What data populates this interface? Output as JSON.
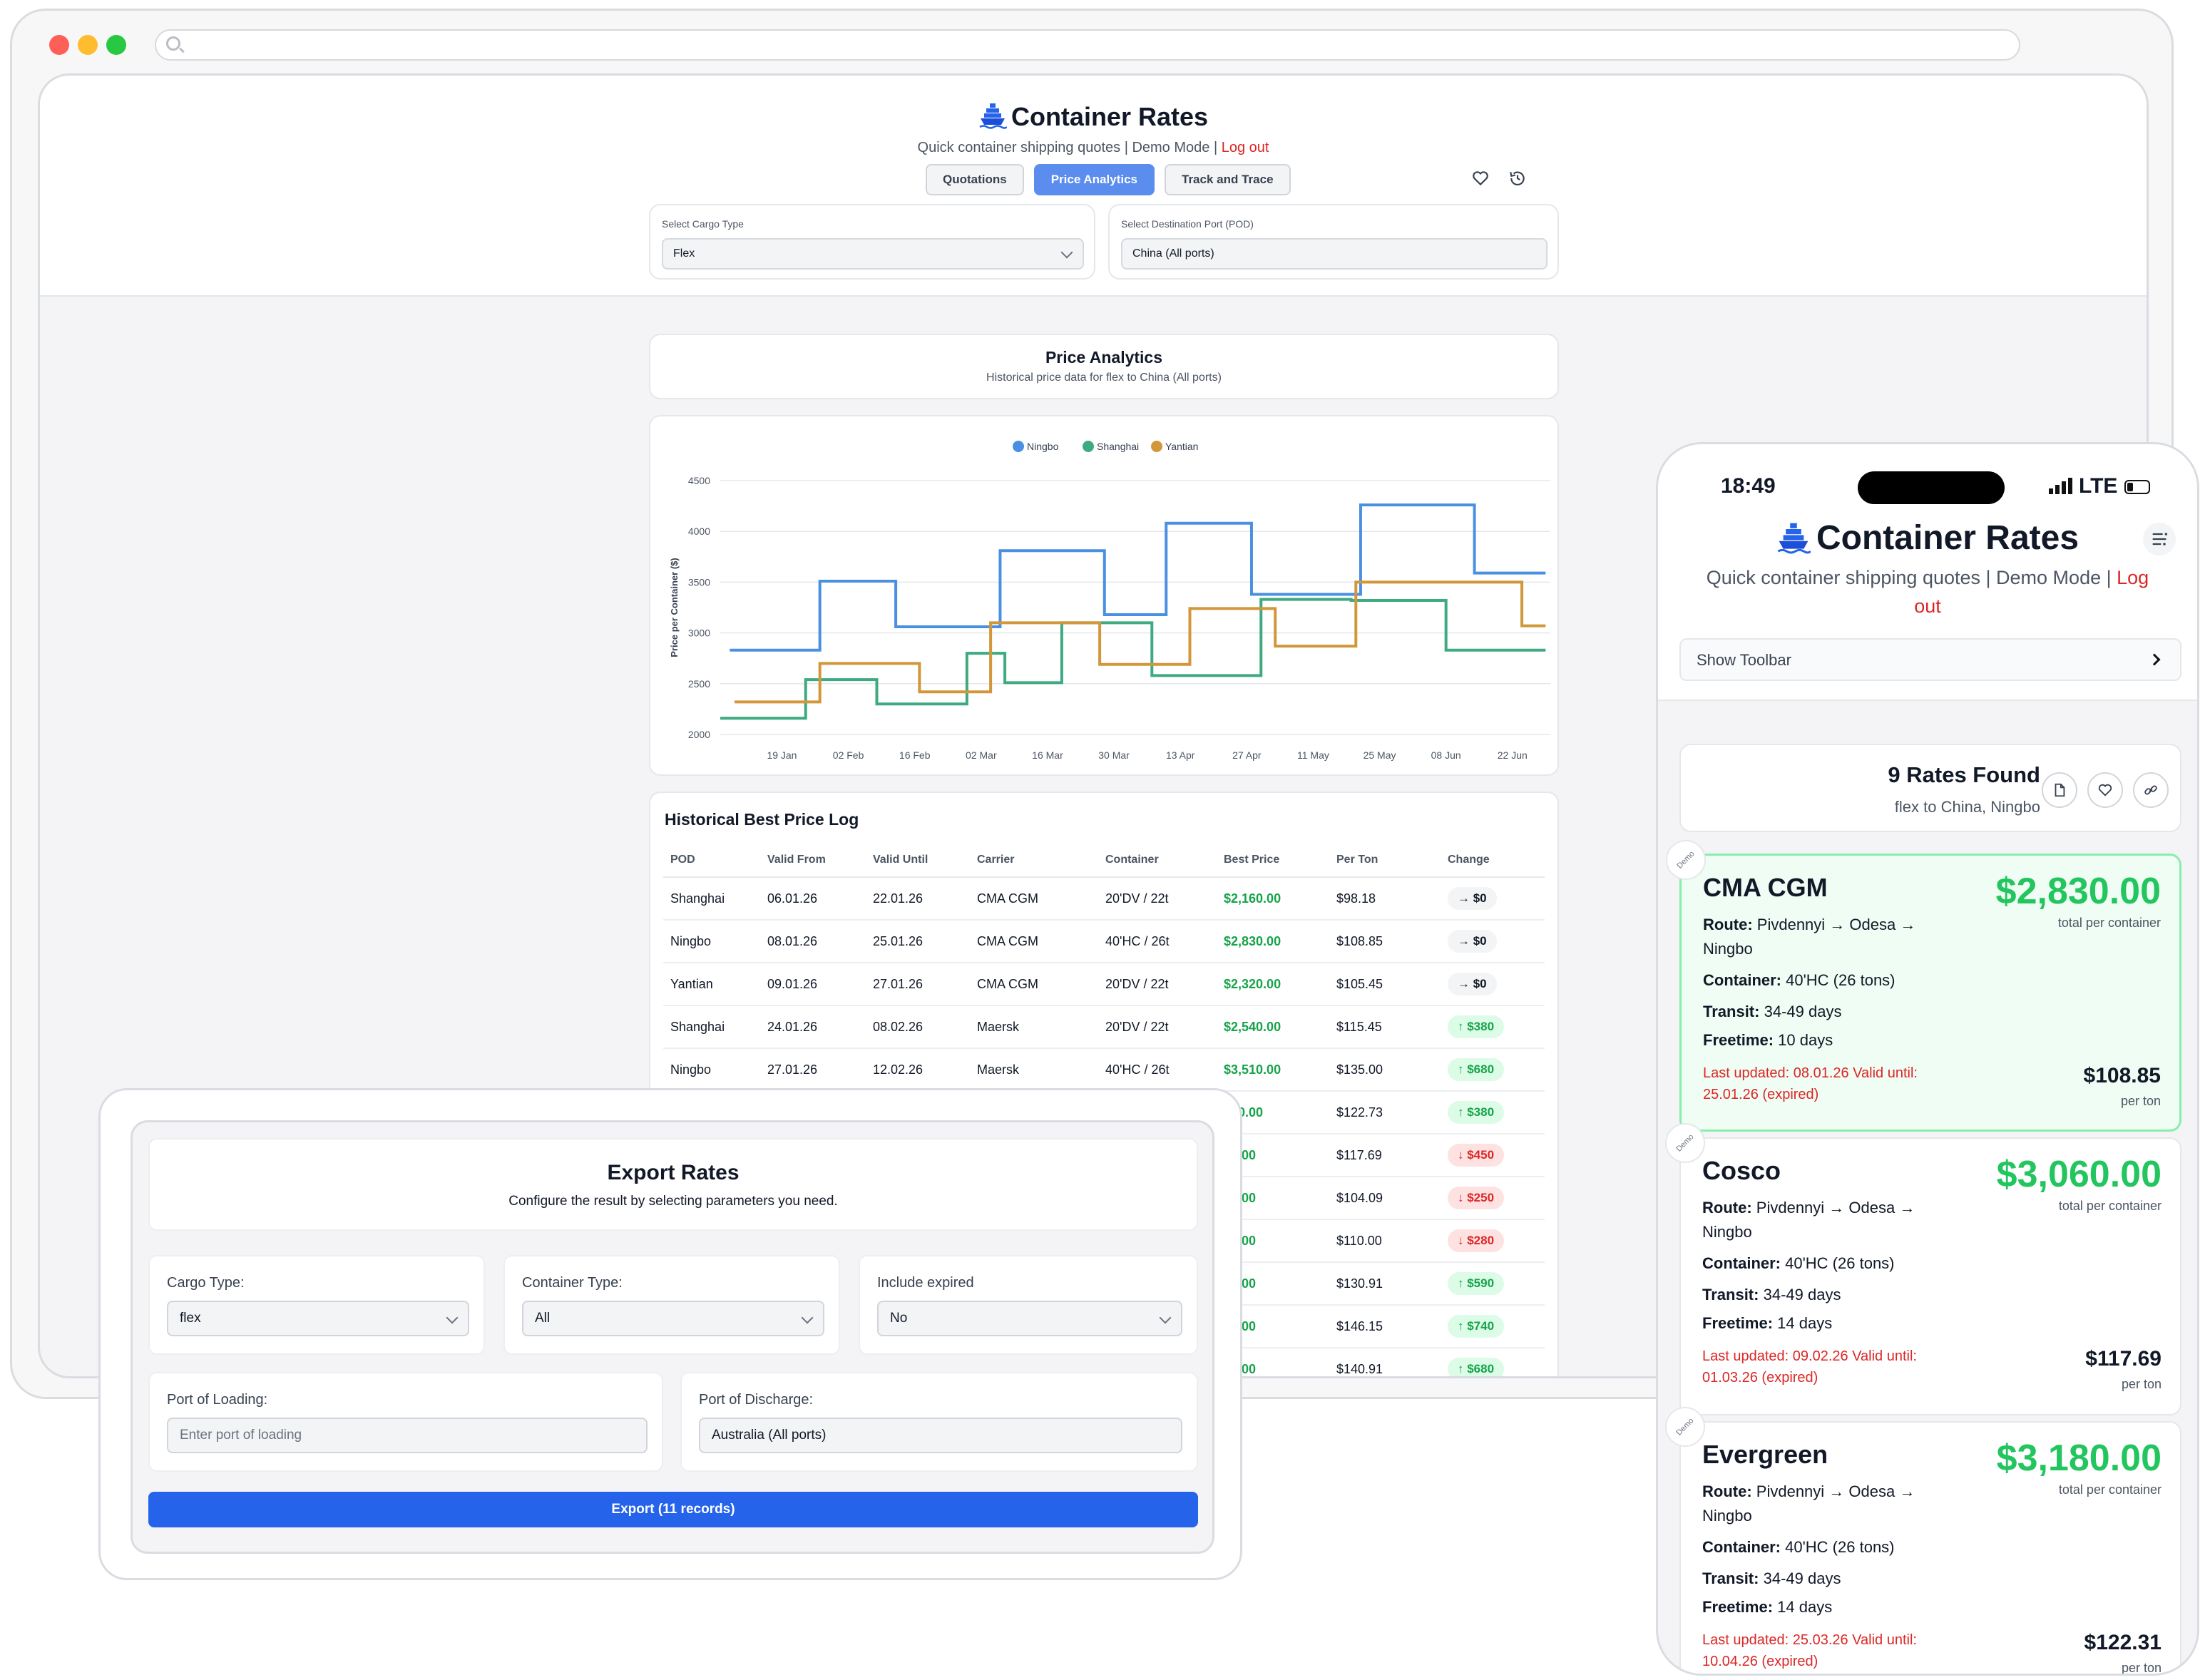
{
  "app": {
    "title": "Container Rates",
    "subtitle_prefix": "Quick container shipping quotes | Demo Mode |",
    "logout": "Log out"
  },
  "tabs": [
    {
      "label": "Quotations",
      "active": false
    },
    {
      "label": "Price Analytics",
      "active": true
    },
    {
      "label": "Track and Trace",
      "active": false
    }
  ],
  "filters": {
    "cargo_label": "Select Cargo Type",
    "cargo_value": "Flex",
    "pod_label": "Select Destination Port (POD)",
    "pod_value": "China (All ports)"
  },
  "analytics": {
    "title": "Price Analytics",
    "subtitle": "Historical price data for flex to China (All ports)"
  },
  "chart_data": {
    "type": "line",
    "ylabel": "Price per Container ($)",
    "xlabel": "",
    "ylim": [
      2000,
      4500
    ],
    "yticks": [
      2000,
      2500,
      3000,
      3500,
      4000,
      4500
    ],
    "xticks": [
      "19 Jan",
      "02 Feb",
      "16 Feb",
      "02 Mar",
      "16 Mar",
      "30 Mar",
      "13 Apr",
      "27 Apr",
      "11 May",
      "25 May",
      "08 Jun",
      "22 Jun"
    ],
    "x_range": [
      "06 Jan",
      "30 Jun"
    ],
    "grid": true,
    "legend": "top-center",
    "step": true,
    "series": [
      {
        "name": "Ningbo",
        "color": "#4a90e2",
        "x": [
          "08 Jan",
          "27 Jan",
          "12 Feb",
          "06 Mar",
          "28 Mar",
          "10 Apr",
          "28 Apr",
          "21 May",
          "14 Jun",
          "29 Jun"
        ],
        "values": [
          2830,
          3510,
          3060,
          3810,
          3180,
          4080,
          3380,
          4260,
          3590,
          3590
        ]
      },
      {
        "name": "Shanghai",
        "color": "#3daa80",
        "x": [
          "06 Jan",
          "24 Jan",
          "08 Feb",
          "27 Feb",
          "07 Mar",
          "19 Mar",
          "07 Apr",
          "30 Apr",
          "19 May",
          "08 Jun",
          "29 Jun"
        ],
        "values": [
          2160,
          2540,
          2300,
          2800,
          2510,
          3100,
          2580,
          3330,
          3320,
          2830,
          2830
        ]
      },
      {
        "name": "Yantian",
        "color": "#d1973a",
        "x": [
          "09 Jan",
          "27 Jan",
          "17 Feb",
          "04 Mar",
          "27 Mar",
          "15 Apr",
          "03 May",
          "20 May",
          "24 Jun",
          "29 Jun"
        ],
        "values": [
          2320,
          2700,
          2420,
          3100,
          2690,
          3240,
          2870,
          3500,
          3070,
          3070
        ]
      }
    ]
  },
  "log": {
    "title": "Historical Best Price Log",
    "columns": [
      "POD",
      "Valid From",
      "Valid Until",
      "Carrier",
      "Container",
      "Best Price",
      "Per Ton",
      "Change"
    ],
    "rows": [
      {
        "pod": "Shanghai",
        "from": "06.01.26",
        "until": "22.01.26",
        "carrier": "CMA CGM",
        "container": "20'DV / 22t",
        "price": "$2,160.00",
        "perton": "$98.18",
        "change": "→ $0",
        "dir": "zero"
      },
      {
        "pod": "Ningbo",
        "from": "08.01.26",
        "until": "25.01.26",
        "carrier": "CMA CGM",
        "container": "40'HC / 26t",
        "price": "$2,830.00",
        "perton": "$108.85",
        "change": "→ $0",
        "dir": "zero"
      },
      {
        "pod": "Yantian",
        "from": "09.01.26",
        "until": "27.01.26",
        "carrier": "CMA CGM",
        "container": "20'DV / 22t",
        "price": "$2,320.00",
        "perton": "$105.45",
        "change": "→ $0",
        "dir": "zero"
      },
      {
        "pod": "Shanghai",
        "from": "24.01.26",
        "until": "08.02.26",
        "carrier": "Maersk",
        "container": "20'DV / 22t",
        "price": "$2,540.00",
        "perton": "$115.45",
        "change": "↑ $380",
        "dir": "up"
      },
      {
        "pod": "Ningbo",
        "from": "27.01.26",
        "until": "12.02.26",
        "carrier": "Maersk",
        "container": "40'HC / 26t",
        "price": "$3,510.00",
        "perton": "$135.00",
        "change": "↑ $680",
        "dir": "up"
      },
      {
        "pod": "",
        "from": "",
        "until": "",
        "carrier": "",
        "container": "",
        "price": "700.00",
        "perton": "$122.73",
        "change": "↑ $380",
        "dir": "up"
      },
      {
        "pod": "",
        "from": "",
        "until": "",
        "carrier": "",
        "container": "",
        "price": "60.00",
        "perton": "$117.69",
        "change": "↓ $450",
        "dir": "down"
      },
      {
        "pod": "",
        "from": "",
        "until": "",
        "carrier": "",
        "container": "",
        "price": "90.00",
        "perton": "$104.09",
        "change": "↓ $250",
        "dir": "down"
      },
      {
        "pod": "",
        "from": "",
        "until": "",
        "carrier": "",
        "container": "",
        "price": "20.00",
        "perton": "$110.00",
        "change": "↓ $280",
        "dir": "down"
      },
      {
        "pod": "",
        "from": "",
        "until": "",
        "carrier": "",
        "container": "",
        "price": "80.00",
        "perton": "$130.91",
        "change": "↑ $590",
        "dir": "up"
      },
      {
        "pod": "",
        "from": "",
        "until": "",
        "carrier": "",
        "container": "",
        "price": "00.00",
        "perton": "$146.15",
        "change": "↑ $740",
        "dir": "up"
      },
      {
        "pod": "",
        "from": "",
        "until": "",
        "carrier": "",
        "container": "",
        "price": "00.00",
        "perton": "$140.91",
        "change": "↑ $680",
        "dir": "up"
      }
    ]
  },
  "export": {
    "title": "Export Rates",
    "subtitle": "Configure the result by selecting parameters you need.",
    "cargo_label": "Cargo Type:",
    "cargo_value": "flex",
    "container_label": "Container Type:",
    "container_value": "All",
    "expired_label": "Include expired",
    "expired_value": "No",
    "pol_label": "Port of Loading:",
    "pol_placeholder": "Enter port of loading",
    "pod_label": "Port of Discharge:",
    "pod_value": "Australia (All ports)",
    "button": "Export (11 records)"
  },
  "phone": {
    "time": "18:49",
    "network": "LTE",
    "title": "Container Rates",
    "subtitle_line1": "Quick container shipping quotes | Demo Mode |",
    "logout_1": "Log",
    "logout_2": "out",
    "toolbar": "Show Toolbar",
    "found_title": "9 Rates Found",
    "found_sub": "flex to China, Ningbo",
    "demo": "Demo",
    "labels": {
      "route": "Route:",
      "container": "Container:",
      "transit": "Transit:",
      "freetime": "Freetime:",
      "total": "total per container",
      "perton": "per ton"
    },
    "rates": [
      {
        "carrier": "CMA CGM",
        "total": "$2,830.00",
        "route_1": "Pivdennyi → Odesa →",
        "route_2": "Ningbo",
        "container": "40'HC (26 tons)",
        "transit": "34-49 days",
        "freetime": "10 days",
        "upd_1": "Last updated: 08.01.26 Valid until:",
        "upd_2": "25.01.26 (expired)",
        "perton": "$108.85"
      },
      {
        "carrier": "Cosco",
        "total": "$3,060.00",
        "route_1": "Pivdennyi → Odesa →",
        "route_2": "Ningbo",
        "container": "40'HC (26 tons)",
        "transit": "34-49 days",
        "freetime": "14 days",
        "upd_1": "Last updated: 09.02.26 Valid until:",
        "upd_2": "01.03.26 (expired)",
        "perton": "$117.69"
      },
      {
        "carrier": "Evergreen",
        "total": "$3,180.00",
        "route_1": "Pivdennyi → Odesa →",
        "route_2": "Ningbo",
        "container": "40'HC (26 tons)",
        "transit": "34-49 days",
        "freetime": "14 days",
        "upd_1": "Last updated: 25.03.26 Valid until:",
        "upd_2": "10.04.26 (expired)",
        "perton": "$122.31"
      }
    ]
  }
}
